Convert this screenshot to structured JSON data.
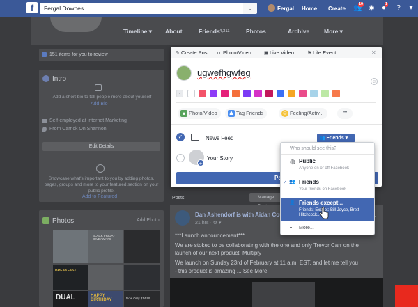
{
  "topbar": {
    "logo": "f",
    "search_value": "Fergal Downes",
    "profile_name": "Fergal",
    "home": "Home",
    "create": "Create",
    "notif_badge_1": "10",
    "notif_badge_2": "1"
  },
  "profile_nav": {
    "tabs": [
      "Timeline ▾",
      "About",
      "Friends",
      "4,311",
      "Photos",
      "Archive",
      "More ▾"
    ]
  },
  "left": {
    "review": "151 items for you to review",
    "intro_title": "Intro",
    "intro_prompt": "Add a short bio to tell people more about yourself",
    "add_bio": "Add Bio",
    "job": "Self-employed at Internet Marketing",
    "from": "From Carrick On Shannon",
    "edit_details": "Edit Details",
    "showcase": "Showcase what's important to you by adding photos, pages, groups and more to your featured section on your public profile.",
    "add_featured": "Add to Featured",
    "photos_title": "Photos",
    "add_photo": "Add Photo",
    "photo_texts": [
      "BLACK FRIDAY GIVEAWAYS",
      "BREAKFAST",
      "DUAL",
      "HAPPY BIRTHDAY",
      "Now Only $14.99"
    ]
  },
  "modal": {
    "tabs": [
      "Create Post",
      "Photo/Video",
      "Live Video",
      "Life Event"
    ],
    "close": "✕",
    "post_text": "ugwefhgwfeg",
    "colors": [
      "#ffffff",
      "#f35369",
      "#8e3cf7",
      "#e5217a",
      "#f46f3b",
      "#7b3bf5",
      "#d531c7",
      "#c2185b",
      "#3b6ff5",
      "#f5a623",
      "#ea4b8a",
      "#a7d3e9",
      "#bce8a5",
      "#f7794a"
    ],
    "actions": [
      "Photo/Video",
      "Tag Friends",
      "Feeling/Activ..."
    ],
    "more": "•••",
    "news_feed": "News Feed",
    "your_story": "Your Story",
    "friends_btn": "Friends ▾",
    "post_btn": "Post"
  },
  "dropdown": {
    "heading": "Who should see this?",
    "options": [
      {
        "title": "Public",
        "sub": "Anyone on or off Facebook"
      },
      {
        "title": "Friends",
        "sub": "Your friends on Facebook"
      },
      {
        "title": "Friends except...",
        "sub": "Friends; Except: Bill Joyce, Brett Hitchcock..."
      }
    ],
    "more": "More..."
  },
  "posts": {
    "label": "Posts",
    "manage": "Manage Posts",
    "author": "Dan Ashendorf is with Aidan Cou...",
    "time": "21 hrs · ⚙ ▾",
    "lines": [
      "***Launch announcement***",
      "We are stoked to be collaborating with the one and only Trevor Carr on the",
      "launch of our next product. Multiply",
      "We launch on Sunday 23rd of February at 11 a.m. EST, and let me tell you",
      "- this product is amazing ... See More"
    ]
  }
}
